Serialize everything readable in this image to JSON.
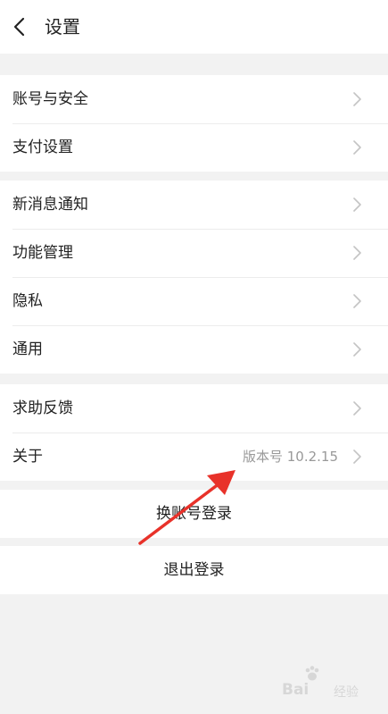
{
  "header": {
    "title": "设置",
    "back_icon": "chevron-left-icon"
  },
  "groups": [
    {
      "rows": [
        {
          "label": "账号与安全"
        },
        {
          "label": "支付设置"
        }
      ]
    },
    {
      "rows": [
        {
          "label": "新消息通知"
        },
        {
          "label": "功能管理"
        },
        {
          "label": "隐私"
        },
        {
          "label": "通用"
        }
      ]
    },
    {
      "rows": [
        {
          "label": "求助反馈"
        },
        {
          "label": "关于",
          "value": "版本号 10.2.15"
        }
      ]
    }
  ],
  "actions": {
    "switch_account": "换账号登录",
    "logout": "退出登录"
  },
  "annotation": {
    "arrow_color": "#e8322a"
  },
  "watermark": {
    "brand": "Bai",
    "sub": "经验"
  },
  "colors": {
    "background": "#f2f2f2",
    "surface": "#ffffff",
    "text": "#222222",
    "secondary_text": "#999999",
    "chevron": "#c4c4c4"
  }
}
